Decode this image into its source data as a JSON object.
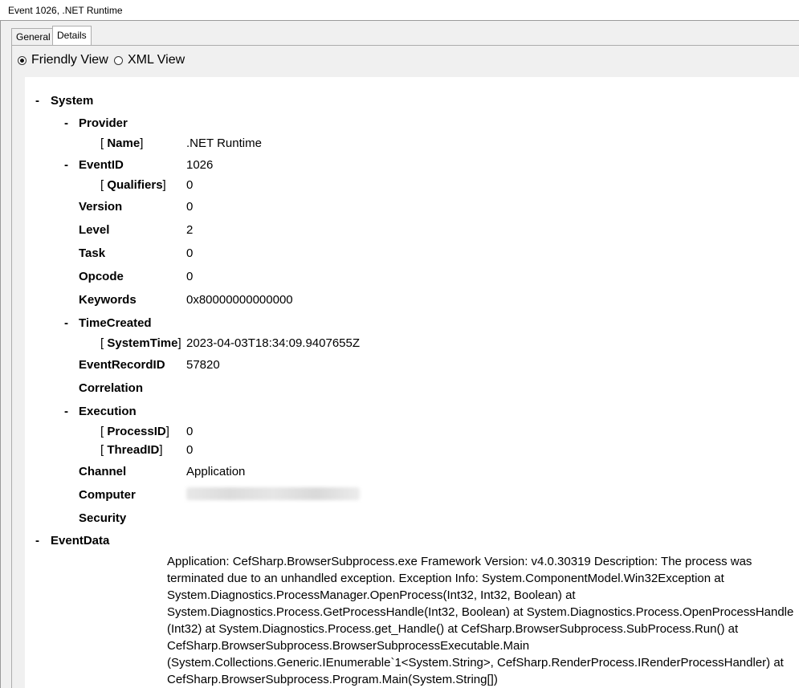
{
  "window": {
    "title": "Event 1026, .NET Runtime"
  },
  "tabs": [
    {
      "label": "General",
      "active": false
    },
    {
      "label": "Details",
      "active": true
    }
  ],
  "view_options": [
    {
      "label": "Friendly View",
      "selected": true
    },
    {
      "label": "XML View",
      "selected": false
    }
  ],
  "tree": {
    "collapse_symbol": "-",
    "bracket_open": "[ ",
    "bracket_close": "]",
    "system": {
      "label": "System"
    },
    "provider": {
      "label": "Provider"
    },
    "name": {
      "label": "Name",
      "value": ".NET Runtime"
    },
    "eventid": {
      "label": "EventID",
      "value": "1026"
    },
    "qualifiers": {
      "label": "Qualifiers",
      "value": "0"
    },
    "version": {
      "label": "Version",
      "value": "0"
    },
    "level": {
      "label": "Level",
      "value": "2"
    },
    "task": {
      "label": "Task",
      "value": "0"
    },
    "opcode": {
      "label": "Opcode",
      "value": "0"
    },
    "keywords": {
      "label": "Keywords",
      "value": "0x80000000000000"
    },
    "timecreated": {
      "label": "TimeCreated"
    },
    "systemtime": {
      "label": "SystemTime",
      "value": "2023-04-03T18:34:09.9407655Z"
    },
    "eventrecordid": {
      "label": "EventRecordID",
      "value": "57820"
    },
    "correlation": {
      "label": "Correlation"
    },
    "execution": {
      "label": "Execution"
    },
    "processid": {
      "label": "ProcessID",
      "value": "0"
    },
    "threadid": {
      "label": "ThreadID",
      "value": "0"
    },
    "channel": {
      "label": "Channel",
      "value": "Application"
    },
    "computer": {
      "label": "Computer"
    },
    "security": {
      "label": "Security"
    },
    "eventdata": {
      "label": "EventData",
      "value": "Application: CefSharp.BrowserSubprocess.exe Framework Version: v4.0.30319 Description: The process was terminated due to an unhandled exception. Exception Info: System.ComponentModel.Win32Exception at System.Diagnostics.ProcessManager.OpenProcess(Int32, Int32, Boolean) at System.Diagnostics.Process.GetProcessHandle(Int32, Boolean) at System.Diagnostics.Process.OpenProcessHandle (Int32) at System.Diagnostics.Process.get_Handle() at CefSharp.BrowserSubprocess.SubProcess.Run() at CefSharp.BrowserSubprocess.BrowserSubprocessExecutable.Main (System.Collections.Generic.IEnumerable`1<System.String>, CefSharp.RenderProcess.IRenderProcessHandler) at CefSharp.BrowserSubprocess.Program.Main(System.String[])"
    }
  }
}
